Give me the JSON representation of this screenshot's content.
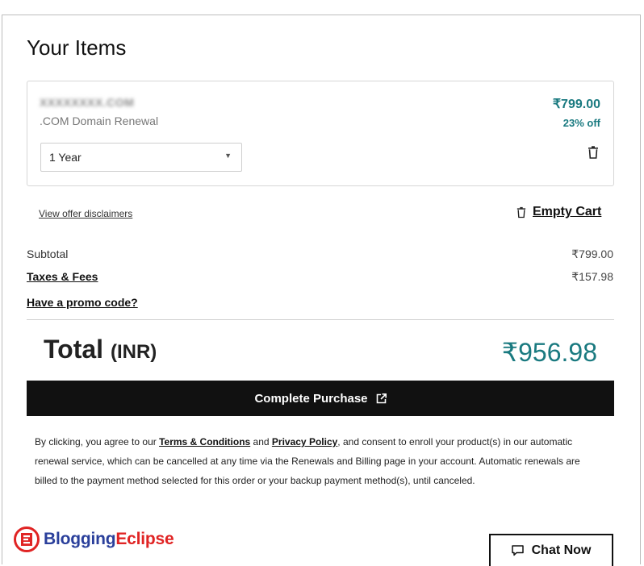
{
  "cart": {
    "title": "Your Items",
    "item": {
      "domain": "XXXXXXXX.COM",
      "description": ".COM Domain Renewal",
      "term_selected": "1 Year",
      "price": "₹799.00",
      "discount": "23% off",
      "delete_icon": "trash-icon"
    },
    "disclaimer_link": "View offer disclaimers",
    "empty_cart_label": "Empty Cart"
  },
  "summary": {
    "subtotal_label": "Subtotal",
    "subtotal_value": "₹799.00",
    "taxes_label": "Taxes & Fees",
    "taxes_value": "₹157.98",
    "promo_label": "Have a promo code?",
    "total_label": "Total",
    "total_currency": "(INR)",
    "total_value": "₹956.98"
  },
  "purchase": {
    "button_label": "Complete Purchase",
    "icon": "external-link-icon"
  },
  "legal": {
    "part1": "By clicking, you agree to our ",
    "terms_link": "Terms & Conditions",
    "part2": " and ",
    "privacy_link": "Privacy Policy",
    "part3": ", and consent to enroll your product(s) in our automatic renewal service, which can be cancelled at any time via the Renewals and Billing page in your account. Automatic renewals are billed to the payment method selected for this order or your backup payment method(s), until canceled."
  },
  "watermark": {
    "part1": "Blogging",
    "part2": "Eclipse"
  },
  "chat": {
    "label": "Chat Now",
    "icon": "chat-bubble-icon"
  },
  "colors": {
    "accent_teal": "#1a7a80",
    "button_dark": "#111111",
    "logo_blue": "#2a3f9b",
    "logo_red": "#e02424"
  }
}
